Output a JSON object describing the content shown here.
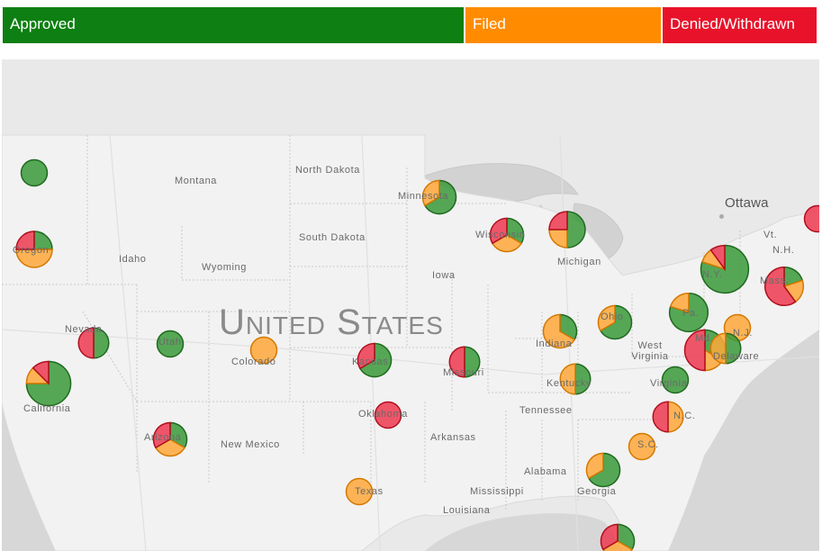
{
  "legend": [
    {
      "label": "Approved",
      "color": "#0e7f12"
    },
    {
      "label": "Filed",
      "color": "#ff8c00"
    },
    {
      "label": "Denied/Withdrawn",
      "color": "#e8132a"
    }
  ],
  "map": {
    "country_label": "United States",
    "city_label": "Ottawa",
    "state_labels": [
      "Montana",
      "North Dakota",
      "Minnesota",
      "South Dakota",
      "Wyoming",
      "Idaho",
      "Oregon",
      "Wisconsin",
      "Michigan",
      "Iowa",
      "N.Y.",
      "Vt.",
      "N.H.",
      "Mass.",
      "Pa.",
      "Nevada",
      "Utah",
      "Colorado",
      "Kansas",
      "Missouri",
      "Ohio",
      "Indiana",
      "West Virginia",
      "N.J.",
      "Md.",
      "Delaware",
      "California",
      "Kentucky",
      "Virginia",
      "Oklahoma",
      "Tennessee",
      "N.C.",
      "Arizona",
      "New Mexico",
      "Arkansas",
      "S.C.",
      "Alabama",
      "Georgia",
      "Mississippi",
      "Texas",
      "Louisiana"
    ]
  },
  "chart_data": {
    "type": "pie",
    "series_names": [
      "Approved",
      "Filed",
      "Denied/Withdrawn"
    ],
    "series_colors": [
      "#3a9a3a",
      "#ffa83a",
      "#ef3a50"
    ],
    "markers": [
      {
        "location": "Washington",
        "approved": 1,
        "filed": 0,
        "denied": 0
      },
      {
        "location": "Oregon",
        "approved": 1,
        "filed": 2,
        "denied": 1
      },
      {
        "location": "California",
        "approved": 6,
        "filed": 1,
        "denied": 1
      },
      {
        "location": "Nevada",
        "approved": 1,
        "filed": 0,
        "denied": 1
      },
      {
        "location": "Utah",
        "approved": 1,
        "filed": 0,
        "denied": 0
      },
      {
        "location": "Arizona",
        "approved": 1,
        "filed": 1,
        "denied": 1
      },
      {
        "location": "Colorado",
        "approved": 0,
        "filed": 1,
        "denied": 0
      },
      {
        "location": "Minnesota",
        "approved": 2,
        "filed": 1,
        "denied": 0
      },
      {
        "location": "Wisconsin",
        "approved": 1,
        "filed": 1,
        "denied": 1
      },
      {
        "location": "Michigan",
        "approved": 2,
        "filed": 1,
        "denied": 1
      },
      {
        "location": "Kansas",
        "approved": 2,
        "filed": 0,
        "denied": 1
      },
      {
        "location": "Missouri",
        "approved": 1,
        "filed": 0,
        "denied": 1
      },
      {
        "location": "Oklahoma",
        "approved": 0,
        "filed": 0,
        "denied": 1
      },
      {
        "location": "Texas",
        "approved": 0,
        "filed": 1,
        "denied": 0
      },
      {
        "location": "Indiana",
        "approved": 1,
        "filed": 2,
        "denied": 0
      },
      {
        "location": "Ohio",
        "approved": 2,
        "filed": 1,
        "denied": 0
      },
      {
        "location": "Kentucky",
        "approved": 1,
        "filed": 1,
        "denied": 0
      },
      {
        "location": "Pennsylvania",
        "approved": 4,
        "filed": 1,
        "denied": 0
      },
      {
        "location": "New York",
        "approved": 8,
        "filed": 1,
        "denied": 1
      },
      {
        "location": "Massachusetts",
        "approved": 1,
        "filed": 1,
        "denied": 3
      },
      {
        "location": "Maine",
        "approved": 0,
        "filed": 0,
        "denied": 1
      },
      {
        "location": "New Jersey",
        "approved": 0,
        "filed": 1,
        "denied": 0
      },
      {
        "location": "Maryland",
        "approved": 2,
        "filed": 1,
        "denied": 3
      },
      {
        "location": "Delaware",
        "approved": 1,
        "filed": 1,
        "denied": 0
      },
      {
        "location": "Virginia",
        "approved": 1,
        "filed": 0,
        "denied": 0
      },
      {
        "location": "North Carolina",
        "approved": 0,
        "filed": 1,
        "denied": 1
      },
      {
        "location": "South Carolina",
        "approved": 0,
        "filed": 1,
        "denied": 0
      },
      {
        "location": "Georgia",
        "approved": 2,
        "filed": 1,
        "denied": 0
      },
      {
        "location": "Florida",
        "approved": 1,
        "filed": 1,
        "denied": 1
      }
    ]
  }
}
